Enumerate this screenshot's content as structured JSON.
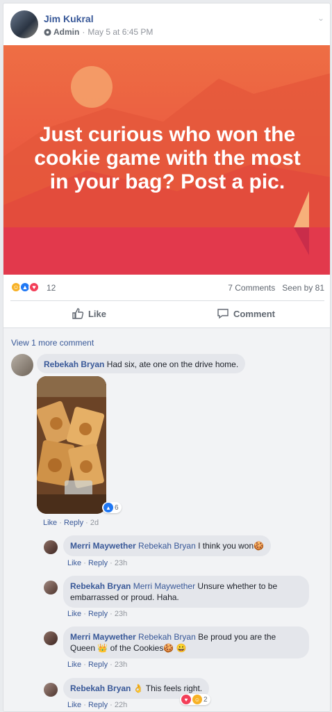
{
  "post": {
    "author": "Jim Kukral",
    "role": "Admin",
    "timestamp": "May 5 at 6:45 PM",
    "banner_text": "Just curious who won the cookie game with the most in your bag? Post a pic.",
    "reaction_count": "12",
    "comments_count": "7 Comments",
    "seen_by": "Seen by 81"
  },
  "actions": {
    "like": "Like",
    "comment": "Comment"
  },
  "comments": {
    "view_more": "View 1 more comment",
    "main": {
      "author": "Rebekah Bryan",
      "text": "Had six, ate one on the drive home.",
      "like": "Like",
      "reply": "Reply",
      "time": "2d",
      "photo_likes": "6"
    },
    "replies": [
      {
        "author": "Merri Maywether",
        "tag": "Rebekah Bryan",
        "text": "I think you won🍪",
        "like": "Like",
        "reply": "Reply",
        "time": "23h"
      },
      {
        "author": "Rebekah Bryan",
        "tag": "Merri Maywether",
        "text": "Unsure whether to be embarrassed or proud. Haha.",
        "like": "Like",
        "reply": "Reply",
        "time": "23h"
      },
      {
        "author": "Merri Maywether",
        "tag": "Rebekah Bryan",
        "text": "Be proud you are the Queen 👑 of the Cookies🍪 😀",
        "like": "Like",
        "reply": "Reply",
        "time": "23h"
      },
      {
        "author": "Rebekah Bryan",
        "tag": "",
        "text": "👌 This feels right.",
        "like": "Like",
        "reply": "Reply",
        "time": "22h",
        "reactions": "2"
      }
    ]
  },
  "colors": {
    "link": "#385898",
    "banner_top": "#ee6e44",
    "banner_bottom": "#e12d44"
  }
}
